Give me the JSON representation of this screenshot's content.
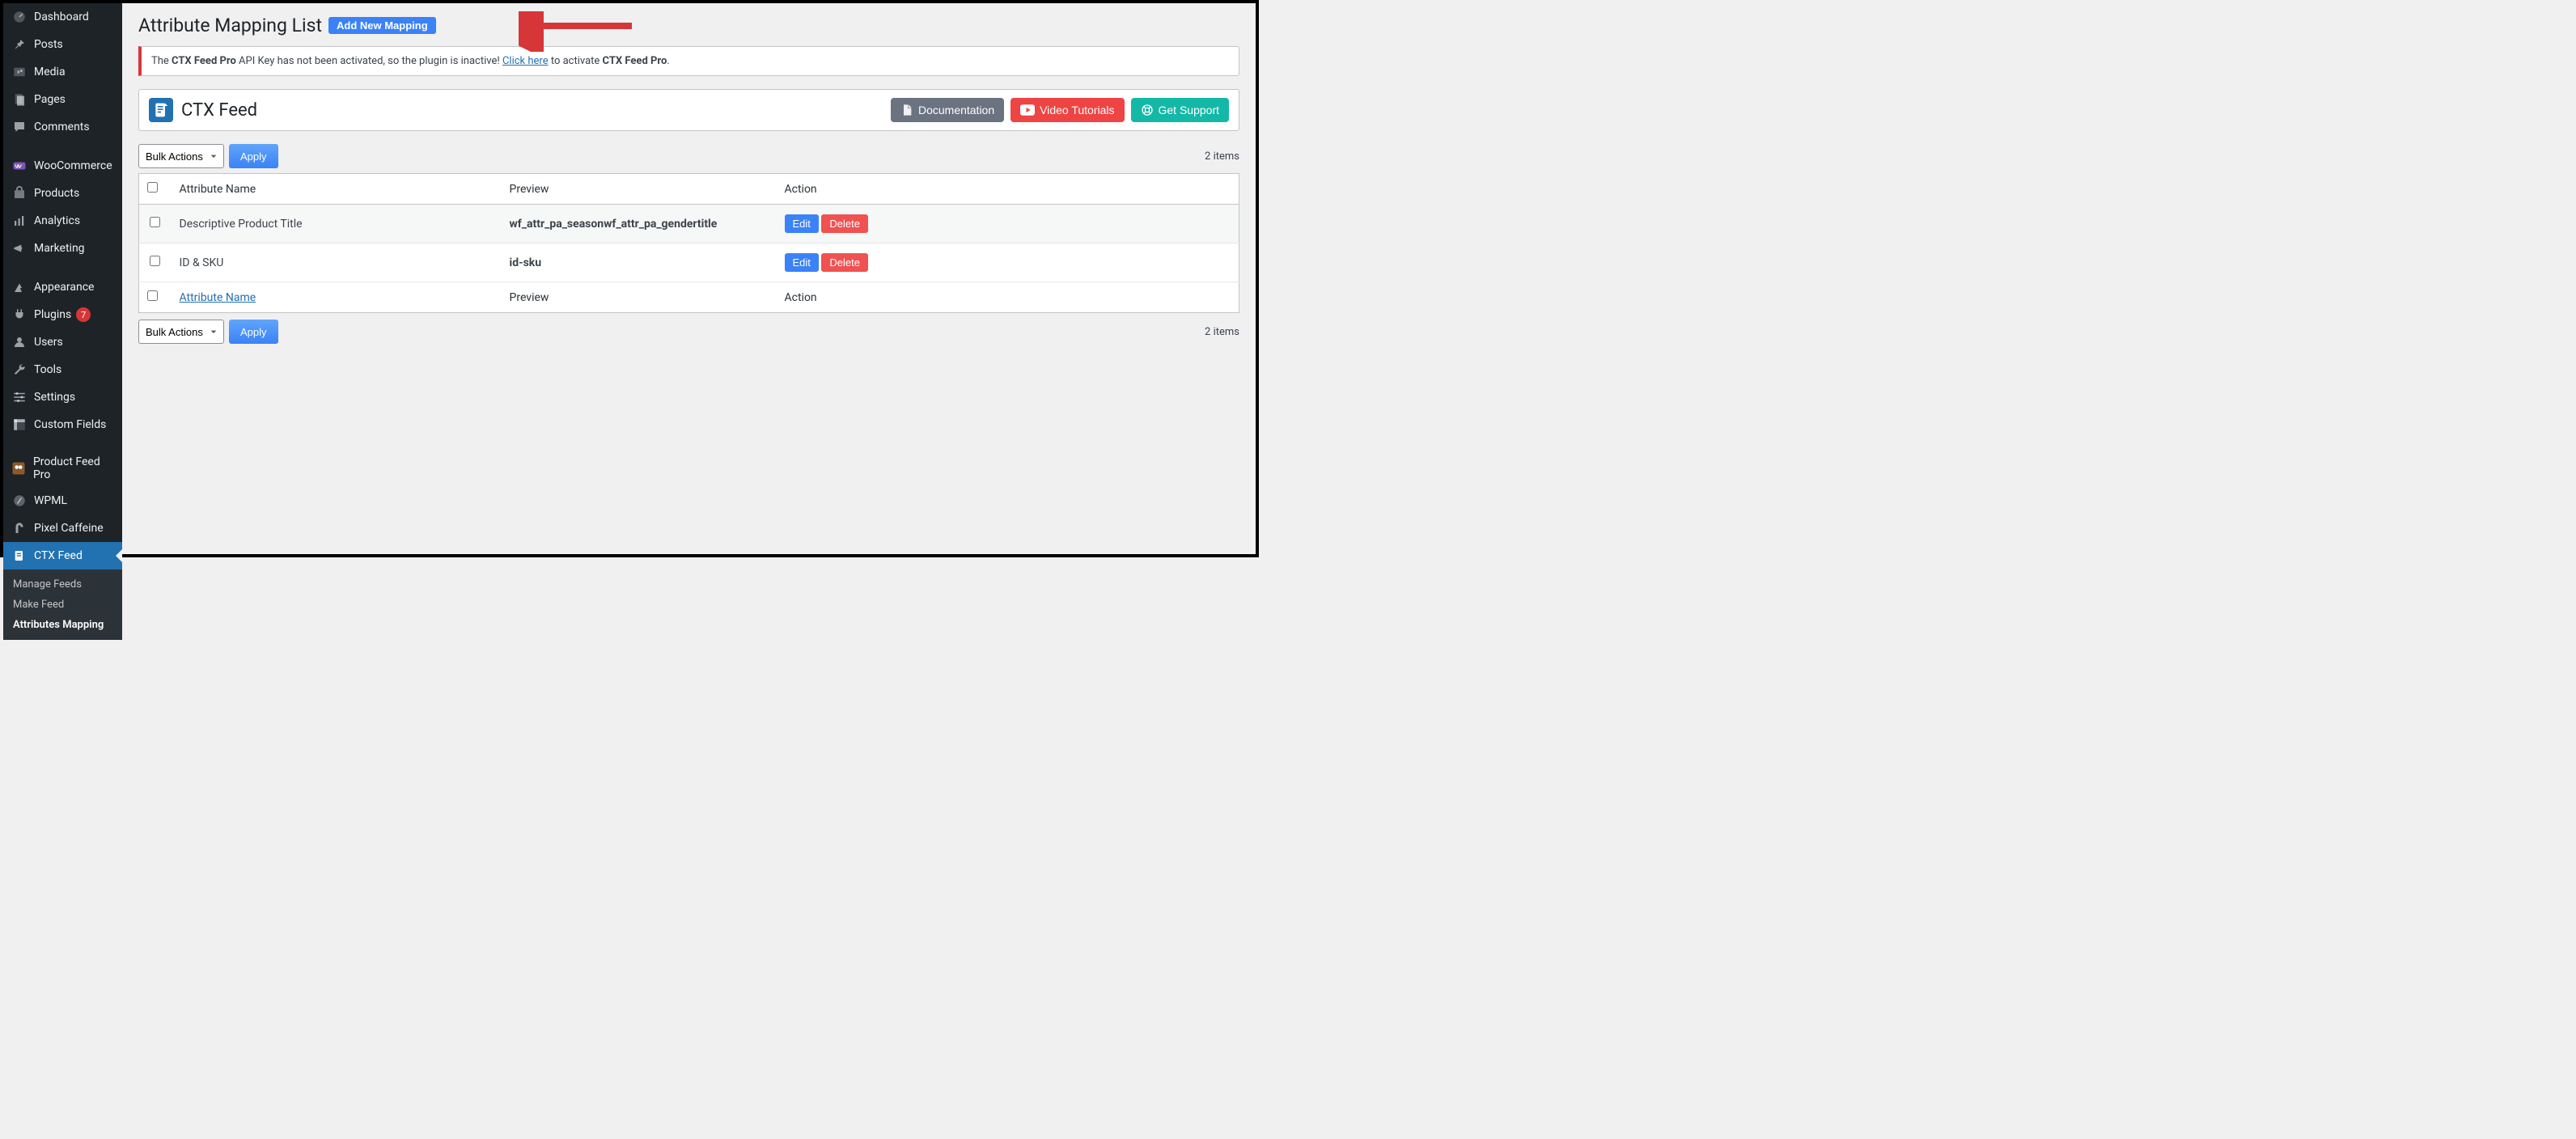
{
  "sidebar": {
    "items": [
      {
        "label": "Dashboard",
        "icon": "dashboard"
      },
      {
        "label": "Posts",
        "icon": "pin"
      },
      {
        "label": "Media",
        "icon": "media"
      },
      {
        "label": "Pages",
        "icon": "pages"
      },
      {
        "label": "Comments",
        "icon": "comments"
      },
      {
        "label": "WooCommerce",
        "icon": "woo"
      },
      {
        "label": "Products",
        "icon": "products"
      },
      {
        "label": "Analytics",
        "icon": "analytics"
      },
      {
        "label": "Marketing",
        "icon": "marketing"
      },
      {
        "label": "Appearance",
        "icon": "appearance"
      },
      {
        "label": "Plugins",
        "icon": "plugins",
        "badge": "7"
      },
      {
        "label": "Users",
        "icon": "users"
      },
      {
        "label": "Tools",
        "icon": "tools"
      },
      {
        "label": "Settings",
        "icon": "settings"
      },
      {
        "label": "Custom Fields",
        "icon": "customfields"
      },
      {
        "label": "Product Feed Pro",
        "icon": "pfp"
      },
      {
        "label": "WPML",
        "icon": "wpml"
      },
      {
        "label": "Pixel Caffeine",
        "icon": "pixel"
      },
      {
        "label": "CTX Feed",
        "icon": "ctx",
        "active": true
      }
    ],
    "submenu": [
      {
        "label": "Manage Feeds"
      },
      {
        "label": "Make Feed"
      },
      {
        "label": "Attributes Mapping",
        "current": true
      }
    ]
  },
  "page": {
    "title": "Attribute Mapping List",
    "add_new": "Add New Mapping"
  },
  "notice": {
    "pre": "The ",
    "strong1": "CTX Feed Pro",
    "mid1": " API Key has not been activated, so the plugin is inactive! ",
    "link": "Click here",
    "mid2": " to activate ",
    "strong2": "CTX Feed Pro",
    "end": "."
  },
  "banner": {
    "title": "CTX Feed",
    "doc": "Documentation",
    "video": "Video Tutorials",
    "support": "Get Support"
  },
  "bulk": {
    "select": "Bulk Actions",
    "apply": "Apply"
  },
  "items_count": "2 items",
  "table": {
    "headers": {
      "attr": "Attribute Name",
      "preview": "Preview",
      "action": "Action"
    },
    "rows": [
      {
        "name": "Descriptive Product Title",
        "preview": "wf_attr_pa_seasonwf_attr_pa_gendertitle"
      },
      {
        "name": "ID & SKU",
        "preview": "id-sku"
      }
    ],
    "edit": "Edit",
    "delete": "Delete"
  }
}
